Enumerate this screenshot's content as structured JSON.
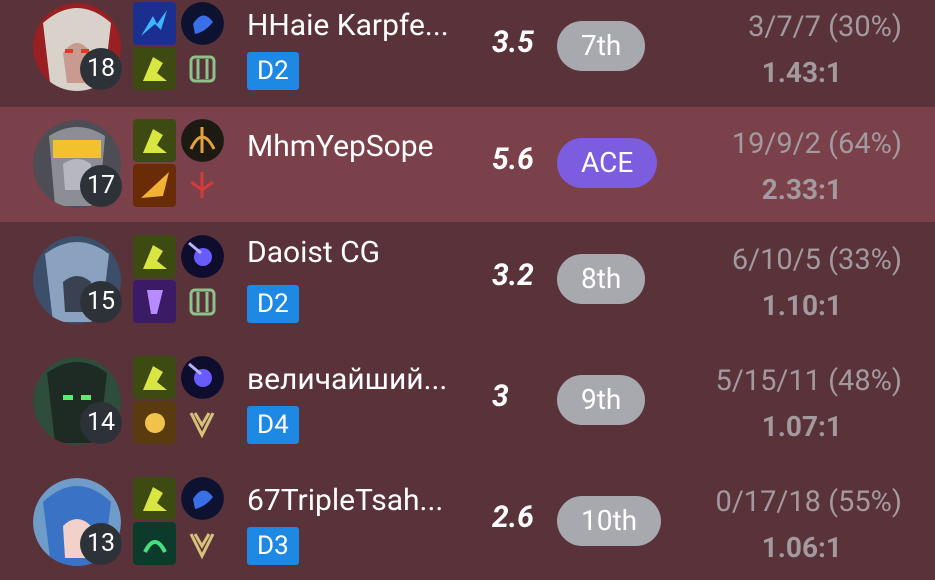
{
  "players": [
    {
      "level": "18",
      "name": "HHaie Karpfe...",
      "rank": "D2",
      "score": "3.5",
      "placement": "7th",
      "kda": "3/7/7 (30%)",
      "ratio": "1.43:1",
      "avatar_color": "#9a1f22",
      "spell_icons": [
        "flash-icon",
        "ghost-icon"
      ],
      "rune_icons": [
        "electrocute-icon",
        "resolve-icon"
      ]
    },
    {
      "level": "17",
      "name": "MhmYepSope",
      "rank": "",
      "score": "5.6",
      "placement": "ACE",
      "kda": "19/9/2 (64%)",
      "ratio": "2.33:1",
      "avatar_color": "#4d4d55",
      "spell_icons": [
        "flash-icon",
        "ignite-icon"
      ],
      "rune_icons": [
        "conqueror-icon",
        "precision-icon"
      ]
    },
    {
      "level": "15",
      "name": "Daoist CG",
      "rank": "D2",
      "score": "3.2",
      "placement": "8th",
      "kda": "6/10/5 (33%)",
      "ratio": "1.10:1",
      "avatar_color": "#3b4e6a",
      "spell_icons": [
        "flash-icon",
        "teleport-icon"
      ],
      "rune_icons": [
        "arcane-comet-icon",
        "resolve-icon"
      ]
    },
    {
      "level": "14",
      "name": "величайший...",
      "rank": "D4",
      "score": "3",
      "placement": "9th",
      "kda": "5/15/11 (48%)",
      "ratio": "1.07:1",
      "avatar_color": "#2e4d3a",
      "spell_icons": [
        "flash-icon",
        "exhaust-icon"
      ],
      "rune_icons": [
        "arcane-comet-icon",
        "inspiration-icon"
      ]
    },
    {
      "level": "13",
      "name": "67TripleTsah...",
      "rank": "D3",
      "score": "2.6",
      "placement": "10th",
      "kda": "0/17/18 (55%)",
      "ratio": "1.06:1",
      "avatar_color": "#6f9cc9",
      "spell_icons": [
        "flash-icon",
        "heal-icon"
      ],
      "rune_icons": [
        "aery-icon",
        "inspiration-icon"
      ]
    }
  ],
  "colors": {
    "row_bg": "#5a3239",
    "row_highlight_bg": "#7a414a",
    "rank_badge": "#1e88e5",
    "placement_pill": "#a8a8af",
    "ace_pill": "#7c5cdf",
    "muted_text": "#a39aa0"
  }
}
